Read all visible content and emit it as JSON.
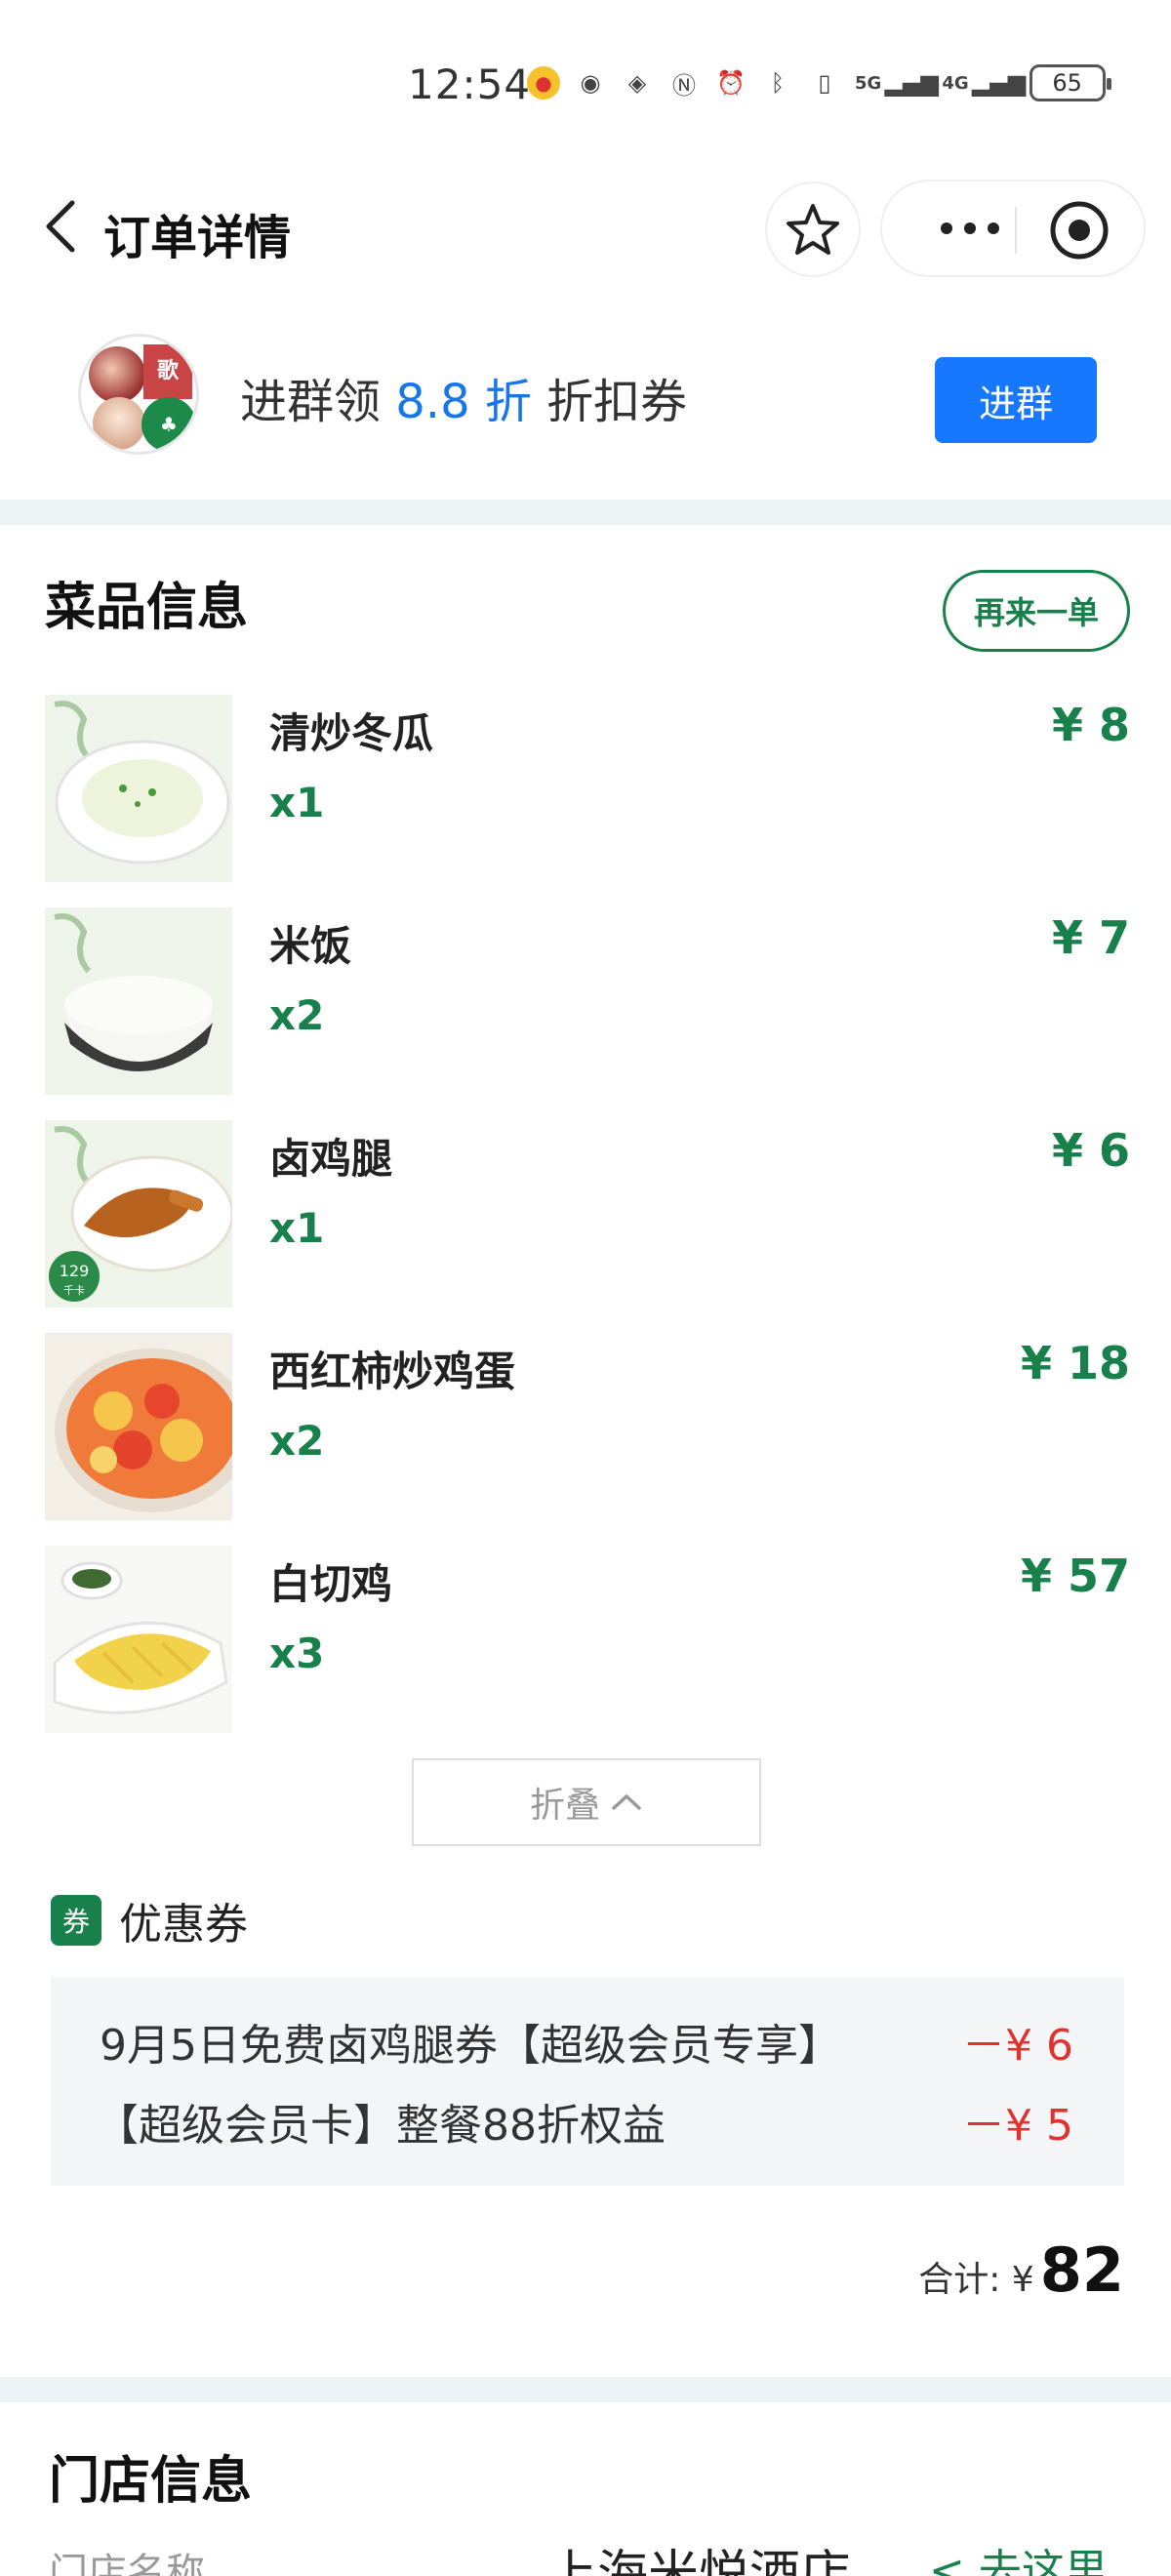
{
  "status_bar": {
    "time": "12:54",
    "signal_5g": "5G",
    "signal_4g": "4G",
    "battery": "65"
  },
  "nav": {
    "title": "订单详情"
  },
  "banner": {
    "text_prefix": "进群领 ",
    "text_highlight": "8.8 折",
    "text_suffix": " 折扣券",
    "join_label": "进群",
    "highlight_color": "#1677e8"
  },
  "dishes_section": {
    "title": "菜品信息",
    "reorder_label": "再来一单",
    "items": [
      {
        "name": "清炒冬瓜",
        "qty": "x1",
        "price": "¥ 8",
        "image": "winter-melon-dish"
      },
      {
        "name": "米饭",
        "qty": "x2",
        "price": "¥ 7",
        "image": "rice-bowl"
      },
      {
        "name": "卤鸡腿",
        "qty": "x1",
        "price": "¥ 6",
        "image": "braised-chicken-leg",
        "badge": "129",
        "badge_unit": "千卡"
      },
      {
        "name": "西红柿炒鸡蛋",
        "qty": "x2",
        "price": "¥ 18",
        "image": "tomato-egg"
      },
      {
        "name": "白切鸡",
        "qty": "x3",
        "price": "¥ 57",
        "image": "white-cut-chicken"
      }
    ],
    "fold_label": "折叠"
  },
  "coupons": {
    "title": "优惠券",
    "tag": "券",
    "items": [
      {
        "name": "9月5日免费卤鸡腿券【超级会员专享】",
        "amount": "－¥ 6"
      },
      {
        "name": "【超级会员卡】整餐88折权益",
        "amount": "－¥ 5"
      }
    ]
  },
  "total": {
    "label": "合计: ¥",
    "value": "82"
  },
  "store_section": {
    "title": "门店信息",
    "rows": [
      {
        "label": "门店名称",
        "value": "上海米悦酒店",
        "action": "< 去这里"
      }
    ]
  },
  "colors": {
    "accent_green": "#18804a",
    "primary_blue": "#1677ff",
    "discount_red": "#e0322f",
    "band_gray": "#edf2f4"
  }
}
